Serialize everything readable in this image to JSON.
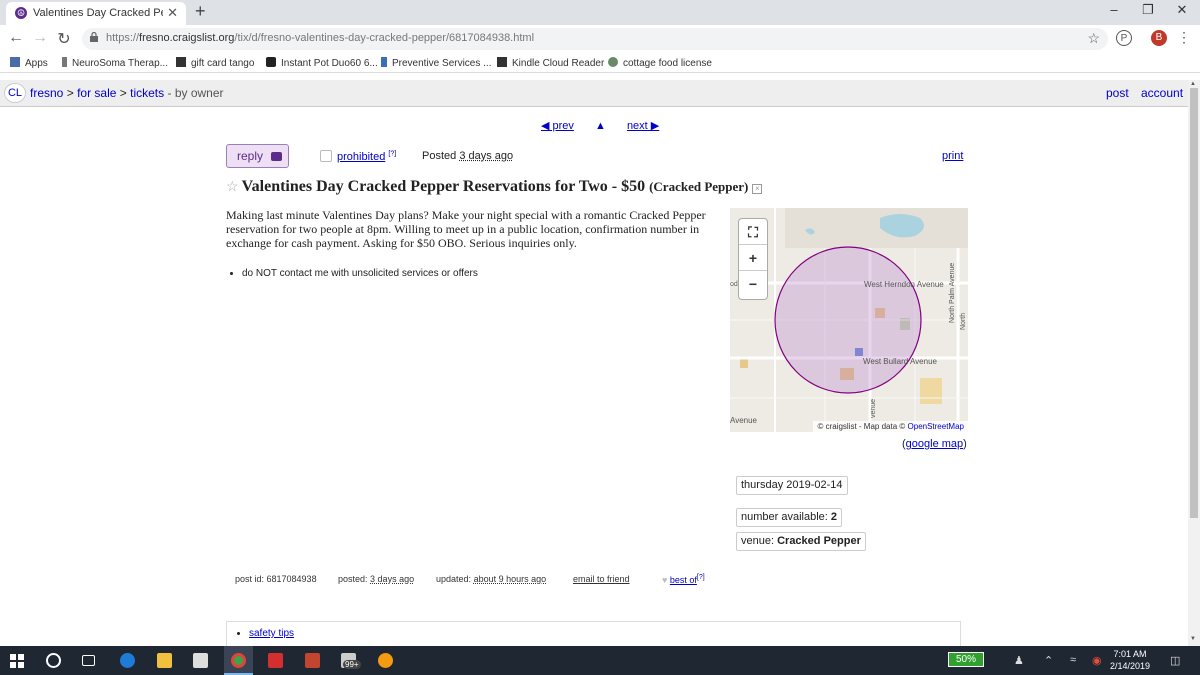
{
  "browser": {
    "tab_title": "Valentines Day Cracked Pepper R",
    "new_tab": "+",
    "window_controls": [
      "–",
      "❐",
      "✕"
    ],
    "url_prefix": "https://",
    "url_host": "fresno.craigslist.org",
    "url_path": "/tix/d/fresno-valentines-day-cracked-pepper/6817084938.html",
    "profile_initial": "B",
    "bookmarks": [
      {
        "label": "Apps",
        "icon": "apps-grid-icon",
        "color": "#4a6da7"
      },
      {
        "label": "NeuroSoma Therap...",
        "icon": "leaf-icon",
        "color": "#555"
      },
      {
        "label": "gift card tango",
        "icon": "giftcard-icon",
        "color": "#333"
      },
      {
        "label": "Instant Pot Duo60 6...",
        "icon": "c-logo-icon",
        "color": "#222"
      },
      {
        "label": "Preventive Services ...",
        "icon": "bookmark-icon",
        "color": "#3b6fb6"
      },
      {
        "label": "Kindle Cloud Reader",
        "icon": "kindle-icon",
        "color": "#333"
      },
      {
        "label": "cottage food license",
        "icon": "seal-icon",
        "color": "#6a8a6a"
      }
    ]
  },
  "header": {
    "logo": "CL",
    "crumbs": [
      "fresno",
      "for sale",
      "tickets"
    ],
    "crumb_sep": ">",
    "crumb_tail": "- by owner",
    "post": "post",
    "account": "account"
  },
  "nav": {
    "prev": "◀ prev",
    "up": "▲",
    "next": "next ▶"
  },
  "posting": {
    "reply": "reply",
    "prohibited": "prohibited",
    "prohibited_sup": "[?]",
    "posted_label": "Posted",
    "posted_value": "3 days ago",
    "print": "print",
    "title": "Valentines Day Cracked Pepper Reservations for Two - $50",
    "title_location": "(Cracked Pepper)",
    "body": "Making last minute Valentines Day plans? Make your night special with a romantic Cracked Pepper reservation for two people at 8pm. Willing to meet up in a public location, confirmation number in exchange for cash payment. Asking for $50 OBO. Serious inquiries only.",
    "notices": [
      "do NOT contact me with unsolicited services or offers"
    ]
  },
  "map": {
    "labels": [
      "West Herndon Avenue",
      "North Palm Avenue",
      "West Bullard Avenue",
      "Avenue",
      "odor",
      "venue",
      "North"
    ],
    "attribution_prefix": "© craigslist - Map data ©",
    "attribution_link": "OpenStreetMap",
    "google_map_open": "(",
    "google_map": "google map",
    "google_map_close": ")",
    "circle_color": "#800080"
  },
  "attributes": {
    "date": "thursday 2019-02-14",
    "available_label": "number available:",
    "available_value": "2",
    "venue_label": "venue:",
    "venue_value": "Cracked Pepper"
  },
  "postinfo": {
    "post_id": "post id: 6817084938",
    "posted_label": "posted:",
    "posted_value": "3 days ago",
    "updated_label": "updated:",
    "updated_value": "about 9 hours ago",
    "email_friend": "email to friend",
    "best_of": "best of",
    "best_of_sup": "[?]"
  },
  "footer": {
    "safety_tips": "safety tips"
  },
  "taskbar": {
    "battery": "50%",
    "time": "7:01 AM",
    "date": "2/14/2019",
    "badge": "99+"
  }
}
